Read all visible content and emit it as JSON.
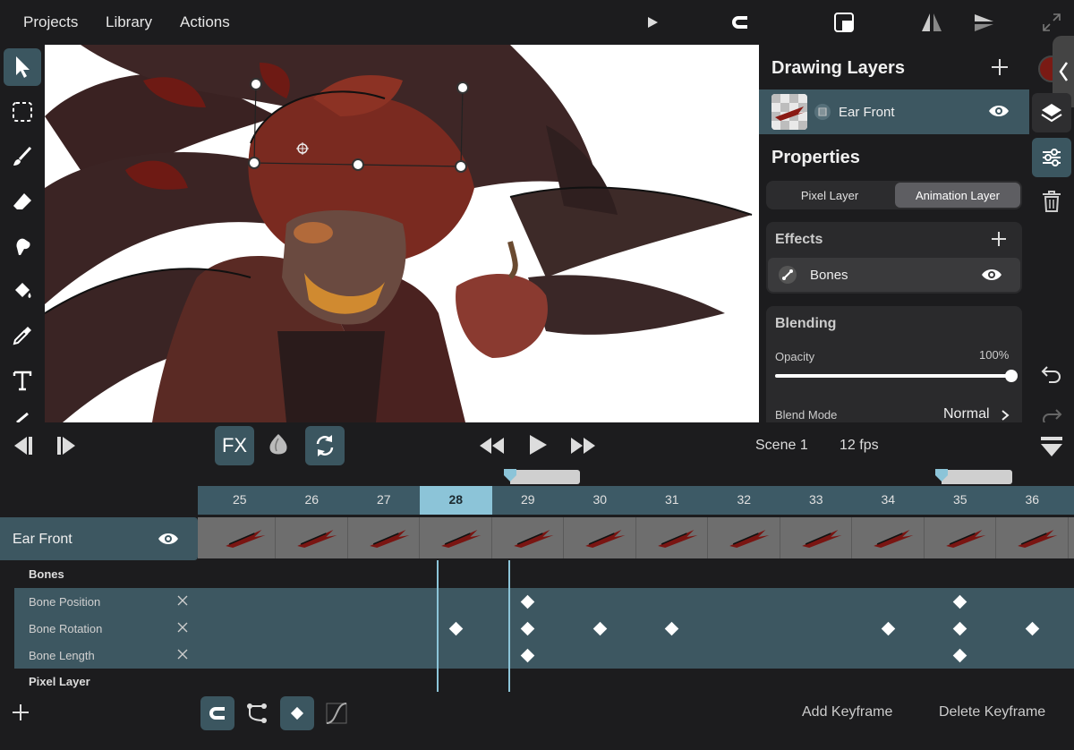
{
  "menu": [
    "Projects",
    "Library",
    "Actions"
  ],
  "panel": {
    "title": "Drawing Layers",
    "layer_name": "Ear Front",
    "properties_title": "Properties",
    "layer_types": [
      "Pixel Layer",
      "Animation Layer"
    ],
    "selected_type": "Animation Layer",
    "effects_title": "Effects",
    "effect_name": "Bones",
    "blending_title": "Blending",
    "opacity_label": "Opacity",
    "opacity_value": "100%",
    "opacity_fraction": 1.0,
    "blend_mode_label": "Blend Mode",
    "blend_mode_value": "Normal"
  },
  "transport": {
    "fx_label": "FX",
    "scene": "Scene 1",
    "fps": "12 fps"
  },
  "timeline": {
    "frames": [
      "25",
      "26",
      "27",
      "28",
      "29",
      "30",
      "31",
      "32",
      "33",
      "34",
      "35",
      "36"
    ],
    "current_frame": "28",
    "layer_name": "Ear Front",
    "group_label": "Bones",
    "properties": [
      "Bone Position",
      "Bone Rotation",
      "Bone Length"
    ],
    "next_group": "Pixel Layer",
    "keyframes": {
      "Bone Position": [
        "29",
        "35"
      ],
      "Bone Rotation": [
        "28",
        "29",
        "30",
        "31",
        "34",
        "35",
        "36"
      ],
      "Bone Length": [
        "29",
        "35"
      ]
    }
  },
  "bottom": {
    "add_keyframe": "Add Keyframe",
    "delete_keyframe": "Delete Keyframe"
  },
  "colors": {
    "accent": "#3d5761",
    "highlight": "#8cc4d8",
    "background": "#1c1c1e"
  }
}
